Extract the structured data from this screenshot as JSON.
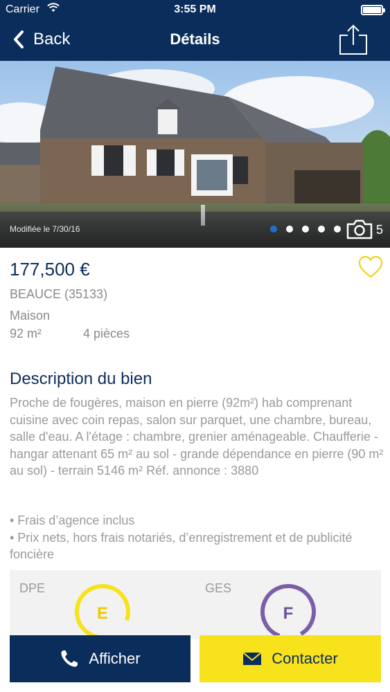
{
  "status_bar": {
    "carrier": "Carrier",
    "time": "3:55 PM"
  },
  "nav": {
    "back_label": "Back",
    "title": "Détails"
  },
  "photo": {
    "modified": "Modifiée le 7/30/16",
    "dots_total": 5,
    "dots_active_index": 0,
    "count": "5"
  },
  "listing": {
    "price": "177,500 €",
    "location": "BEAUCE (35133)",
    "type": "Maison",
    "surface": "92 m²",
    "rooms": "4 pièces"
  },
  "description": {
    "title": "Description du bien",
    "text": "Proche de fougères, maison en pierre (92m²) hab comprenant cuisine avec coin repas, salon sur parquet, une chambre, bureau, salle d'eau. A l'étage : chambre, grenier aménageable. Chaufferie - hangar attenant 65 m² au sol - grande dépendance en pierre (90 m² au sol) - terrain 5146 m² Réf. annonce : 3880",
    "bullets": [
      "• Frais d’agence inclus",
      "• Prix nets, hors frais notariés, d’enregistrement et de publicité foncière"
    ]
  },
  "energy": {
    "dpe": {
      "label": "DPE",
      "grade": "E",
      "color": "#f7e21b"
    },
    "ges": {
      "label": "GES",
      "grade": "F",
      "color": "#7a5fa8"
    }
  },
  "actions": {
    "afficher": "Afficher",
    "contacter": "Contacter"
  },
  "colors": {
    "brand_navy": "#0b2d5b",
    "accent_yellow": "#f7e21b",
    "active_dot": "#1e6fd0"
  }
}
